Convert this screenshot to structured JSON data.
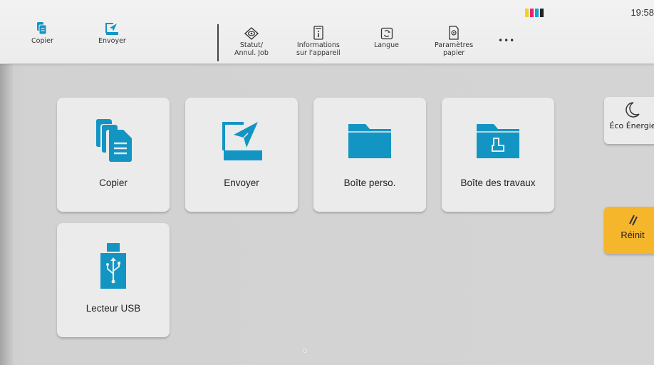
{
  "status": {
    "time": "19:58",
    "toner_colors": [
      "#f2d21b",
      "#e0287a",
      "#18a0d8",
      "#222222"
    ]
  },
  "topbar": {
    "items": [
      {
        "label": "Copier",
        "icon": "copy-icon"
      },
      {
        "label": "Envoyer",
        "icon": "send-icon"
      },
      {
        "label": "Statut/\nAnnul. Job",
        "icon": "eye-icon"
      },
      {
        "label": "Informations\nsur l'appareil",
        "icon": "info-icon"
      },
      {
        "label": "Langue",
        "icon": "language-icon"
      },
      {
        "label": "Paramètres\npapier",
        "icon": "paper-settings-icon"
      }
    ],
    "more": "•••"
  },
  "tiles": [
    {
      "label": "Copier",
      "icon": "copy-icon"
    },
    {
      "label": "Envoyer",
      "icon": "send-icon"
    },
    {
      "label": "Boîte perso.",
      "icon": "folder-icon"
    },
    {
      "label": "Boîte des travaux",
      "icon": "job-box-icon"
    },
    {
      "label": "Lecteur USB",
      "icon": "usb-icon"
    }
  ],
  "side": {
    "eco_label": "Éco Énergie",
    "reset_label": "Réinit"
  },
  "colors": {
    "accent": "#1395c4",
    "reset": "#f6b62b"
  }
}
